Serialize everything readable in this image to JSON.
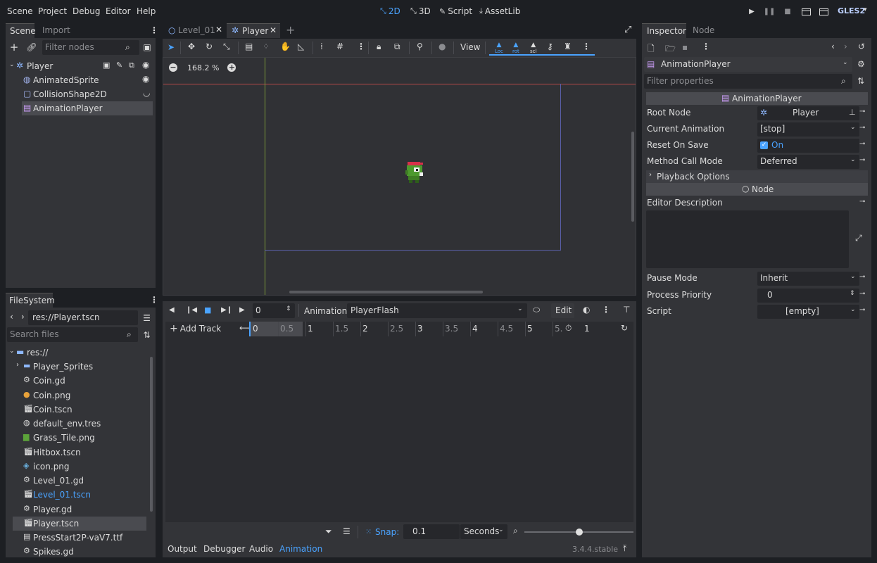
{
  "menu": [
    "Scene",
    "Project",
    "Debug",
    "Editor",
    "Help"
  ],
  "modes": {
    "m2d": "2D",
    "m3d": "3D",
    "script": "Script",
    "assetlib": "AssetLib"
  },
  "renderer": "GLES2",
  "scene_dock": {
    "tabs": [
      "Scene",
      "Import"
    ],
    "filter_placeholder": "Filter nodes",
    "nodes": [
      {
        "label": "Player",
        "icon": "player-node-icon"
      },
      {
        "label": "AnimatedSprite",
        "icon": "animated-sprite-icon"
      },
      {
        "label": "CollisionShape2D",
        "icon": "collision-shape-icon"
      },
      {
        "label": "AnimationPlayer",
        "icon": "animation-player-icon"
      }
    ]
  },
  "filesystem": {
    "tab": "FileSystem",
    "path": "res://Player.tscn",
    "search_placeholder": "Search files",
    "root": "res://",
    "items": [
      {
        "name": "Player_Sprites",
        "type": "folder"
      },
      {
        "name": "Coin.gd",
        "type": "script"
      },
      {
        "name": "Coin.png",
        "type": "image-coin"
      },
      {
        "name": "Coin.tscn",
        "type": "scene"
      },
      {
        "name": "default_env.tres",
        "type": "env"
      },
      {
        "name": "Grass_Tile.png",
        "type": "image-grass"
      },
      {
        "name": "Hitbox.tscn",
        "type": "scene"
      },
      {
        "name": "icon.png",
        "type": "image-icon"
      },
      {
        "name": "Level_01.gd",
        "type": "script"
      },
      {
        "name": "Level_01.tscn",
        "type": "scene"
      },
      {
        "name": "Player.gd",
        "type": "script"
      },
      {
        "name": "Player.tscn",
        "type": "scene"
      },
      {
        "name": "PressStart2P-vaV7.ttf",
        "type": "font"
      },
      {
        "name": "Spikes.gd",
        "type": "script"
      }
    ]
  },
  "editor_tabs": [
    {
      "label": "Level_01"
    },
    {
      "label": "Player"
    }
  ],
  "toolbar": {
    "view": "View",
    "snap_icons": [
      "Loc",
      "rot",
      "scl"
    ]
  },
  "viewport": {
    "zoom": "168.2 %"
  },
  "animation": {
    "time_value": "0",
    "anim_label": "Animation",
    "current": "PlayerFlash",
    "edit": "Edit",
    "add_track": "Add Track",
    "ruler": [
      "0",
      "0.5",
      "1",
      "1.5",
      "2",
      "2.5",
      "3",
      "3.5",
      "4",
      "4.5",
      "5",
      "5."
    ],
    "length": "1",
    "snap_label": "Snap:",
    "snap_value": "0.1",
    "snap_unit": "Seconds"
  },
  "bottom_tabs": [
    "Output",
    "Debugger",
    "Audio",
    "Animation"
  ],
  "version": "3.4.4.stable",
  "inspector": {
    "tabs": [
      "Inspector",
      "Node"
    ],
    "object": "AnimationPlayer",
    "filter_placeholder": "Filter properties",
    "section": "AnimationPlayer",
    "props": [
      {
        "name": "Root Node",
        "value": "Player"
      },
      {
        "name": "Current Animation",
        "value": "[stop]"
      },
      {
        "name": "Reset On Save",
        "value": "On"
      },
      {
        "name": "Method Call Mode",
        "value": "Deferred"
      }
    ],
    "playback": "Playback Options",
    "node_section": "Node",
    "editor_desc": "Editor Description",
    "props2": [
      {
        "name": "Pause Mode",
        "value": "Inherit"
      },
      {
        "name": "Process Priority",
        "value": "0"
      },
      {
        "name": "Script",
        "value": "[empty]"
      }
    ]
  },
  "colors": {
    "accent": "#4aa3ff",
    "panel": "#333438",
    "background": "#1d1f23"
  }
}
